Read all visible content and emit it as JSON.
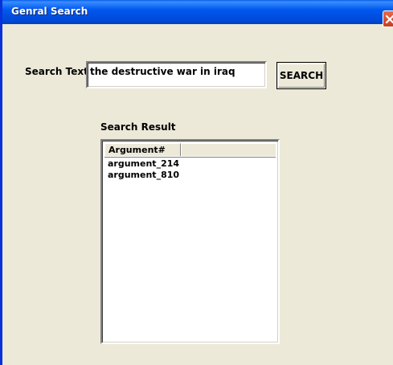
{
  "window": {
    "title": "Genral Search",
    "close_icon": "close-icon"
  },
  "search": {
    "label": "Search Text",
    "value": "the destructive war in iraq",
    "button_label": "SEARCH"
  },
  "results": {
    "heading": "Search Result",
    "columns": [
      "Argument#"
    ],
    "rows": [
      "argument_214",
      "argument_810"
    ]
  },
  "colors": {
    "titlebar": "#0058ee",
    "window_bg": "#ece9d8",
    "close_button": "#c64021"
  }
}
